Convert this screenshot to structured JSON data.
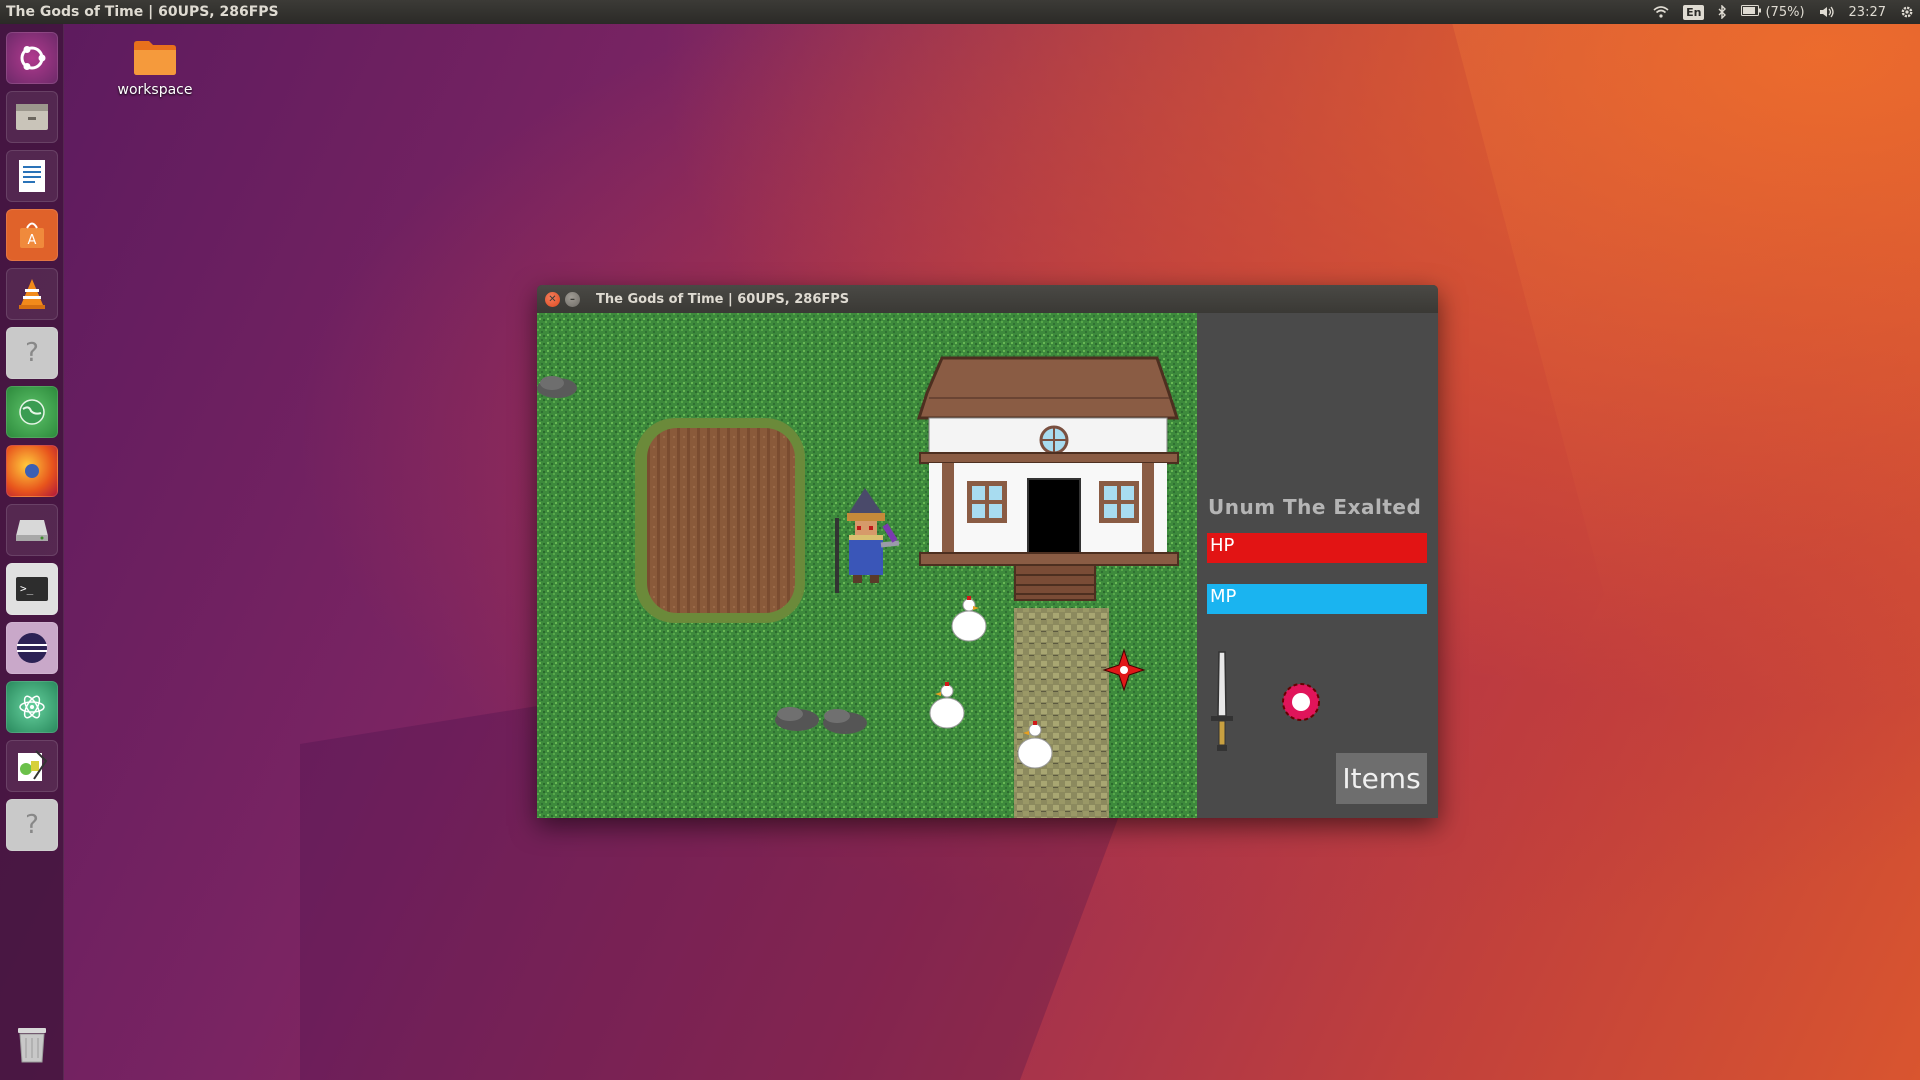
{
  "top_panel": {
    "title": "The Gods of Time | 60UPS, 286FPS",
    "keyboard_layout": "En",
    "battery": "(75%)",
    "clock": "23:27"
  },
  "desktop": {
    "icons": [
      {
        "label": "workspace",
        "icon": "folder-icon"
      }
    ]
  },
  "launcher": {
    "items": [
      "ubuntu-logo-icon",
      "files-icon",
      "writer-icon",
      "software-center-icon",
      "vlc-icon",
      "help-icon",
      "globe-icon",
      "firefox-icon",
      "disk-icon",
      "terminal-icon",
      "eclipse-icon",
      "atom-icon",
      "drawing-icon",
      "help-icon",
      "trash-icon"
    ]
  },
  "window": {
    "title": "The Gods of Time | 60UPS, 286FPS",
    "hud": {
      "character_name": "Unum The Exalted",
      "hp_label": "HP",
      "mp_label": "MP",
      "items_button": "Items"
    }
  },
  "colors": {
    "hp": "#e21414",
    "mp": "#1ab4f0",
    "grass": "#3c8a3a"
  }
}
